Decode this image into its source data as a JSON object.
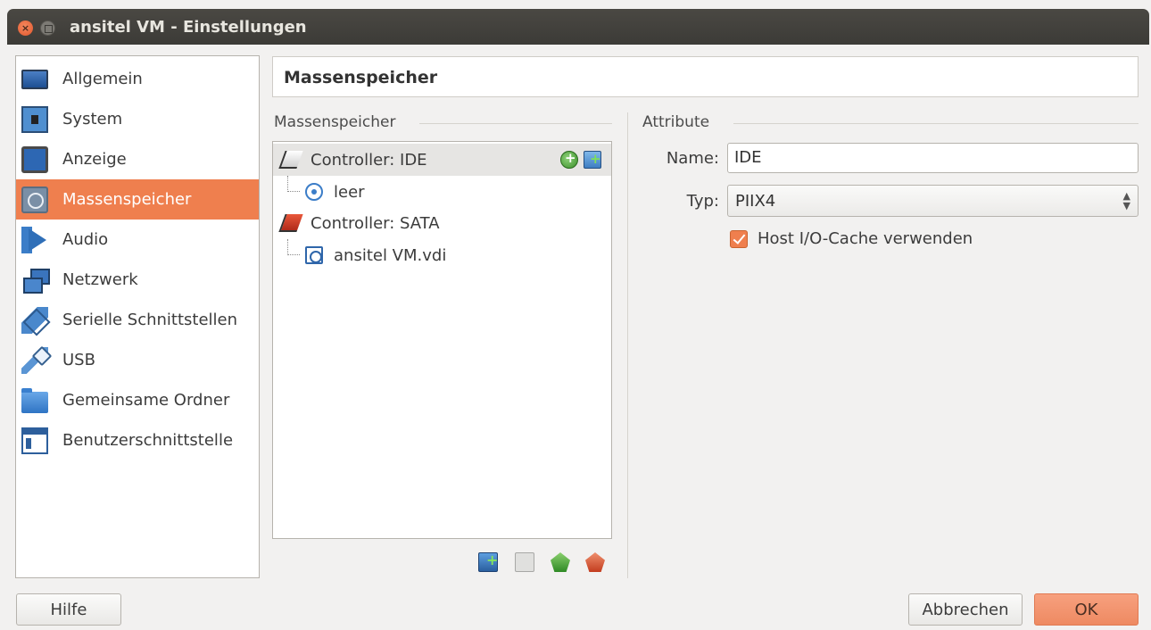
{
  "window": {
    "title": "ansitel VM - Einstellungen"
  },
  "sidebar": {
    "items": [
      {
        "label": "Allgemein",
        "icon": "general-icon"
      },
      {
        "label": "System",
        "icon": "system-chip-icon"
      },
      {
        "label": "Anzeige",
        "icon": "display-icon"
      },
      {
        "label": "Massenspeicher",
        "icon": "storage-icon",
        "selected": true
      },
      {
        "label": "Audio",
        "icon": "audio-icon"
      },
      {
        "label": "Netzwerk",
        "icon": "network-icon"
      },
      {
        "label": "Serielle Schnittstellen",
        "icon": "serial-port-icon"
      },
      {
        "label": "USB",
        "icon": "usb-icon"
      },
      {
        "label": "Gemeinsame Ordner",
        "icon": "shared-folder-icon"
      },
      {
        "label": "Benutzerschnittstelle",
        "icon": "user-interface-icon"
      }
    ]
  },
  "page": {
    "title": "Massenspeicher"
  },
  "storage": {
    "group_title": "Massenspeicher",
    "tree": [
      {
        "label": "Controller: IDE",
        "type": "controller-ide",
        "selected": true
      },
      {
        "label": "leer",
        "type": "optical-drive"
      },
      {
        "label": "Controller: SATA",
        "type": "controller-sata"
      },
      {
        "label": "ansitel VM.vdi",
        "type": "hard-disk"
      }
    ]
  },
  "attributes": {
    "group_title": "Attribute",
    "name_label": "Name:",
    "name_value": "IDE",
    "type_label": "Typ:",
    "type_value": "PIIX4",
    "cache_label": "Host I/O-Cache verwenden",
    "cache_checked": true
  },
  "buttons": {
    "help": "Hilfe",
    "cancel": "Abbrechen",
    "ok": "OK"
  },
  "colors": {
    "accent": "#ef7f4e",
    "titlebar": "#3c3b37",
    "background": "#f2f1f0"
  }
}
